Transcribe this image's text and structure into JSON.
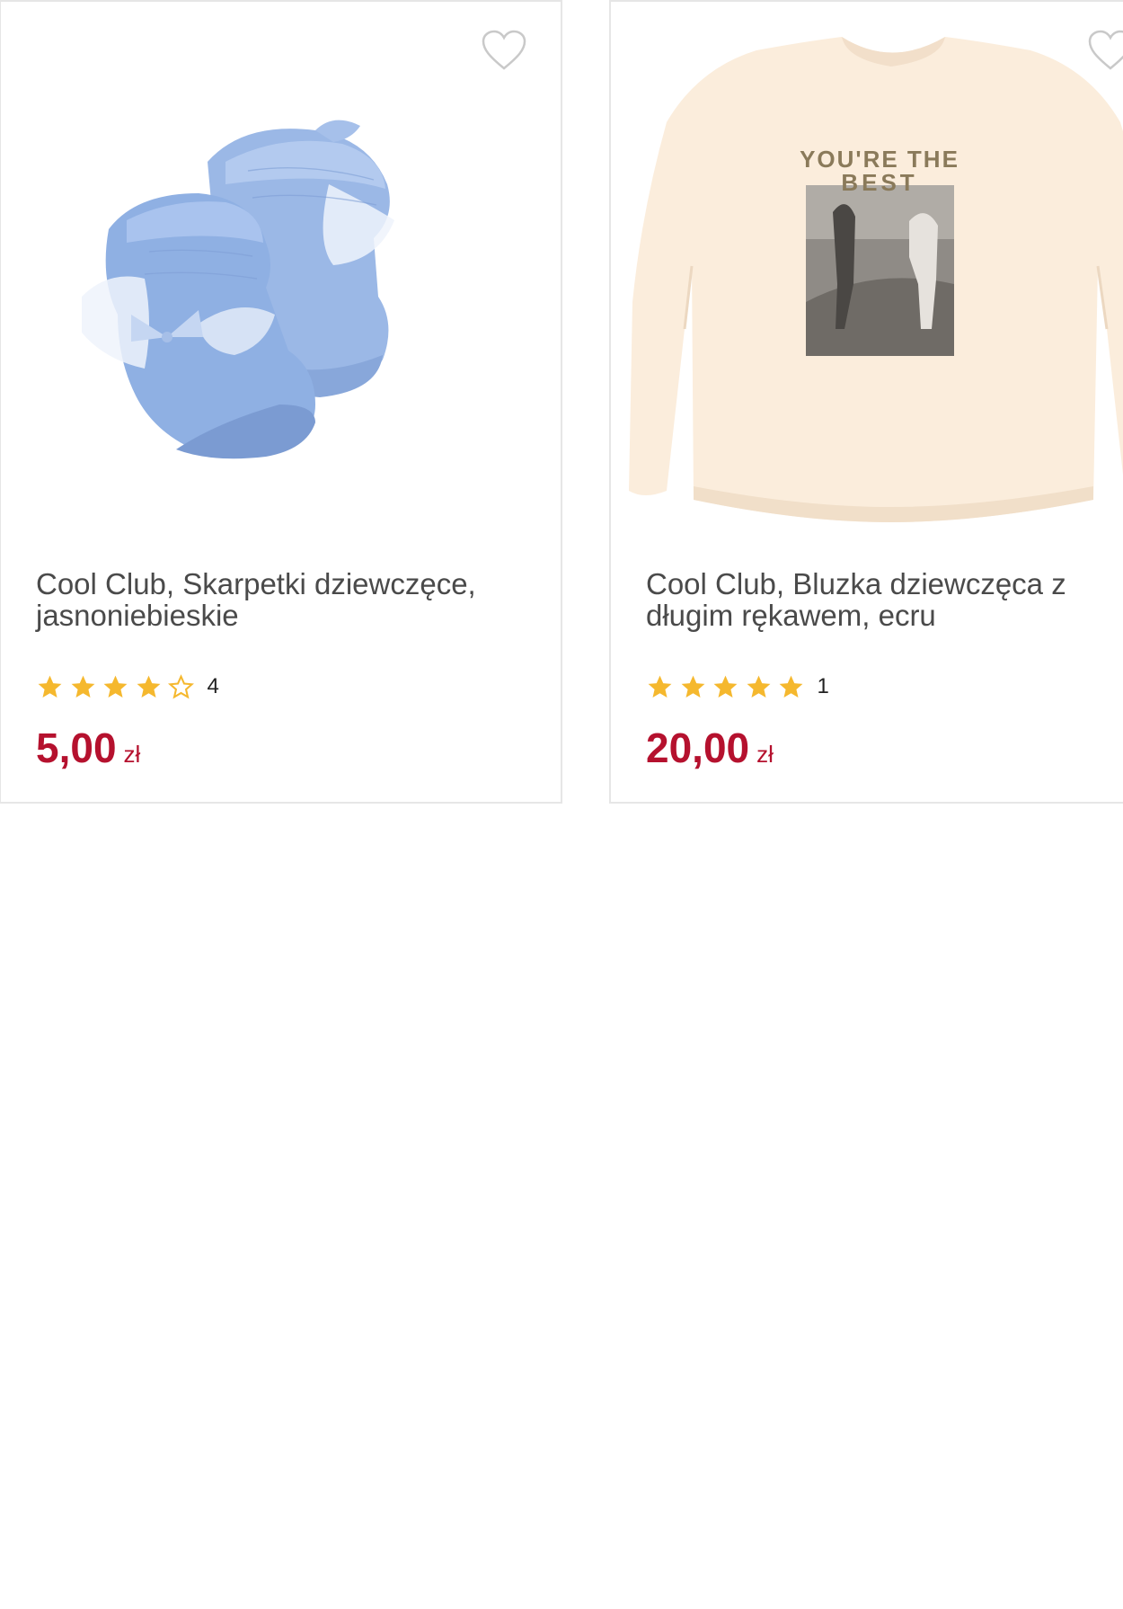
{
  "products": [
    {
      "title": "Cool Club, Skarpetki dziewczęce, jasnoniebieskie",
      "rating": 4,
      "rating_count": "4",
      "price": "5,00",
      "currency": "zł",
      "image_icon": "baby-socks-image"
    },
    {
      "title": "Cool Club, Bluzka dziewczęca z długim rękawem, ecru",
      "rating": 5,
      "rating_count": "1",
      "price": "20,00",
      "currency": "zł",
      "image_icon": "tshirt-image",
      "print_text": "YOU'RE THE BEST"
    }
  ],
  "colors": {
    "price": "#b5112e",
    "star": "#f5b82e",
    "border": "#e6e6e6",
    "title": "#4a4a4a"
  }
}
